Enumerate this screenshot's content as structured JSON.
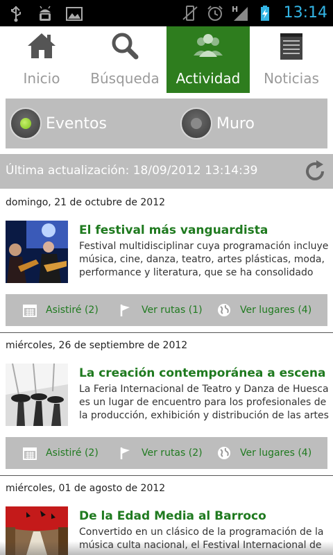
{
  "status_bar": {
    "left_icons": [
      "usb-icon",
      "android-debug-icon",
      "image-icon"
    ],
    "right_icons": [
      "vibrate-off-icon",
      "alarm-icon",
      "signal-h-icon",
      "battery-charging-icon"
    ],
    "signal_letter": "H",
    "time": "13:14"
  },
  "tabs": [
    {
      "label": "Inicio",
      "icon": "home-icon",
      "active": false
    },
    {
      "label": "Búsqueda",
      "icon": "search-icon",
      "active": false
    },
    {
      "label": "Actividad",
      "icon": "people-icon",
      "active": true
    },
    {
      "label": "Noticias",
      "icon": "notepad-icon",
      "active": false
    }
  ],
  "segment": {
    "options": [
      {
        "label": "Eventos",
        "checked": true
      },
      {
        "label": "Muro",
        "checked": false
      }
    ]
  },
  "update_bar": {
    "text": "Última actualización: 18/09/2012 13:14:39",
    "refresh_icon": "refresh-icon"
  },
  "events": [
    {
      "date": "domingo, 21 de octubre de 2012",
      "title": "El festival más vanguardista",
      "description": "Festival multidisciplinar cuya programación incluye música, cine, danza, teatro, artes plásticas, moda, performance y literatura, que se ha consolidado",
      "actions": {
        "attended": "Asistiré (2)",
        "routes": "Ver rutas (1)",
        "places": "Ver lugares (4)"
      }
    },
    {
      "date": "miércoles, 26 de septiembre de 2012",
      "title": "La creación contemporánea a escena en",
      "description": "La Feria Internacional de Teatro y Danza de Huesca es un lugar de encuentro para los profesionales de la producción, exhibición y distribución de las artes",
      "actions": {
        "attended": "Asistiré (2)",
        "routes": "Ver rutas (2)",
        "places": "Ver lugares (4)"
      }
    },
    {
      "date": "miércoles, 01 de agosto de 2012",
      "title": "De la Edad Media al Barroco",
      "description": "Convertido en un clásico de la programación de la música culta nacional, el Festival Internacional de"
    }
  ],
  "colors": {
    "accent_green": "#2e7d1e",
    "link_green": "#1f7a1f",
    "bar_gray": "#bdbdbd",
    "status_blue": "#33b5e5"
  }
}
